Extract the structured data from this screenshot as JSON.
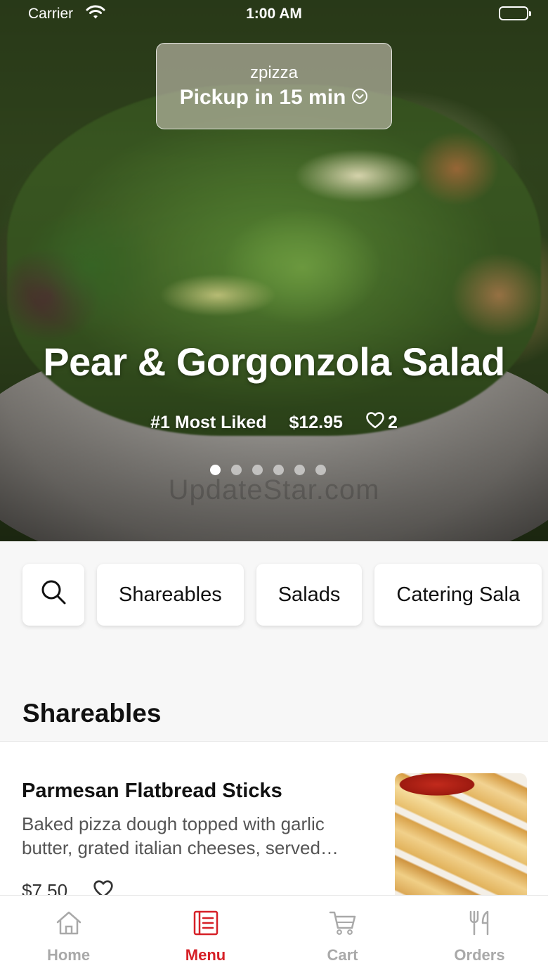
{
  "status_bar": {
    "carrier": "Carrier",
    "time": "1:00 AM"
  },
  "pickup": {
    "store": "zpizza",
    "label": "Pickup in 15 min"
  },
  "hero": {
    "title": "Pear & Gorgonzola Salad",
    "rank": "#1 Most Liked",
    "price": "$12.95",
    "likes": "2",
    "carousel": {
      "total": 6,
      "active": 1
    },
    "watermark": "UpdateStar.com"
  },
  "categories": {
    "search_icon": "search-icon",
    "items": [
      "Shareables",
      "Salads",
      "Catering Sala"
    ]
  },
  "section": {
    "title": "Shareables"
  },
  "items": [
    {
      "name": "Parmesan Flatbread Sticks",
      "description": "Baked pizza dough topped with garlic butter, grated italian cheeses, served…",
      "price": "$7.50"
    }
  ],
  "tabbar": {
    "tabs": [
      {
        "label": "Home",
        "icon": "home-icon"
      },
      {
        "label": "Menu",
        "icon": "menu-icon"
      },
      {
        "label": "Cart",
        "icon": "cart-icon"
      },
      {
        "label": "Orders",
        "icon": "fork-knife-icon"
      }
    ],
    "active": "Menu",
    "active_color": "#d62027",
    "inactive_color": "#a9a9a9"
  }
}
